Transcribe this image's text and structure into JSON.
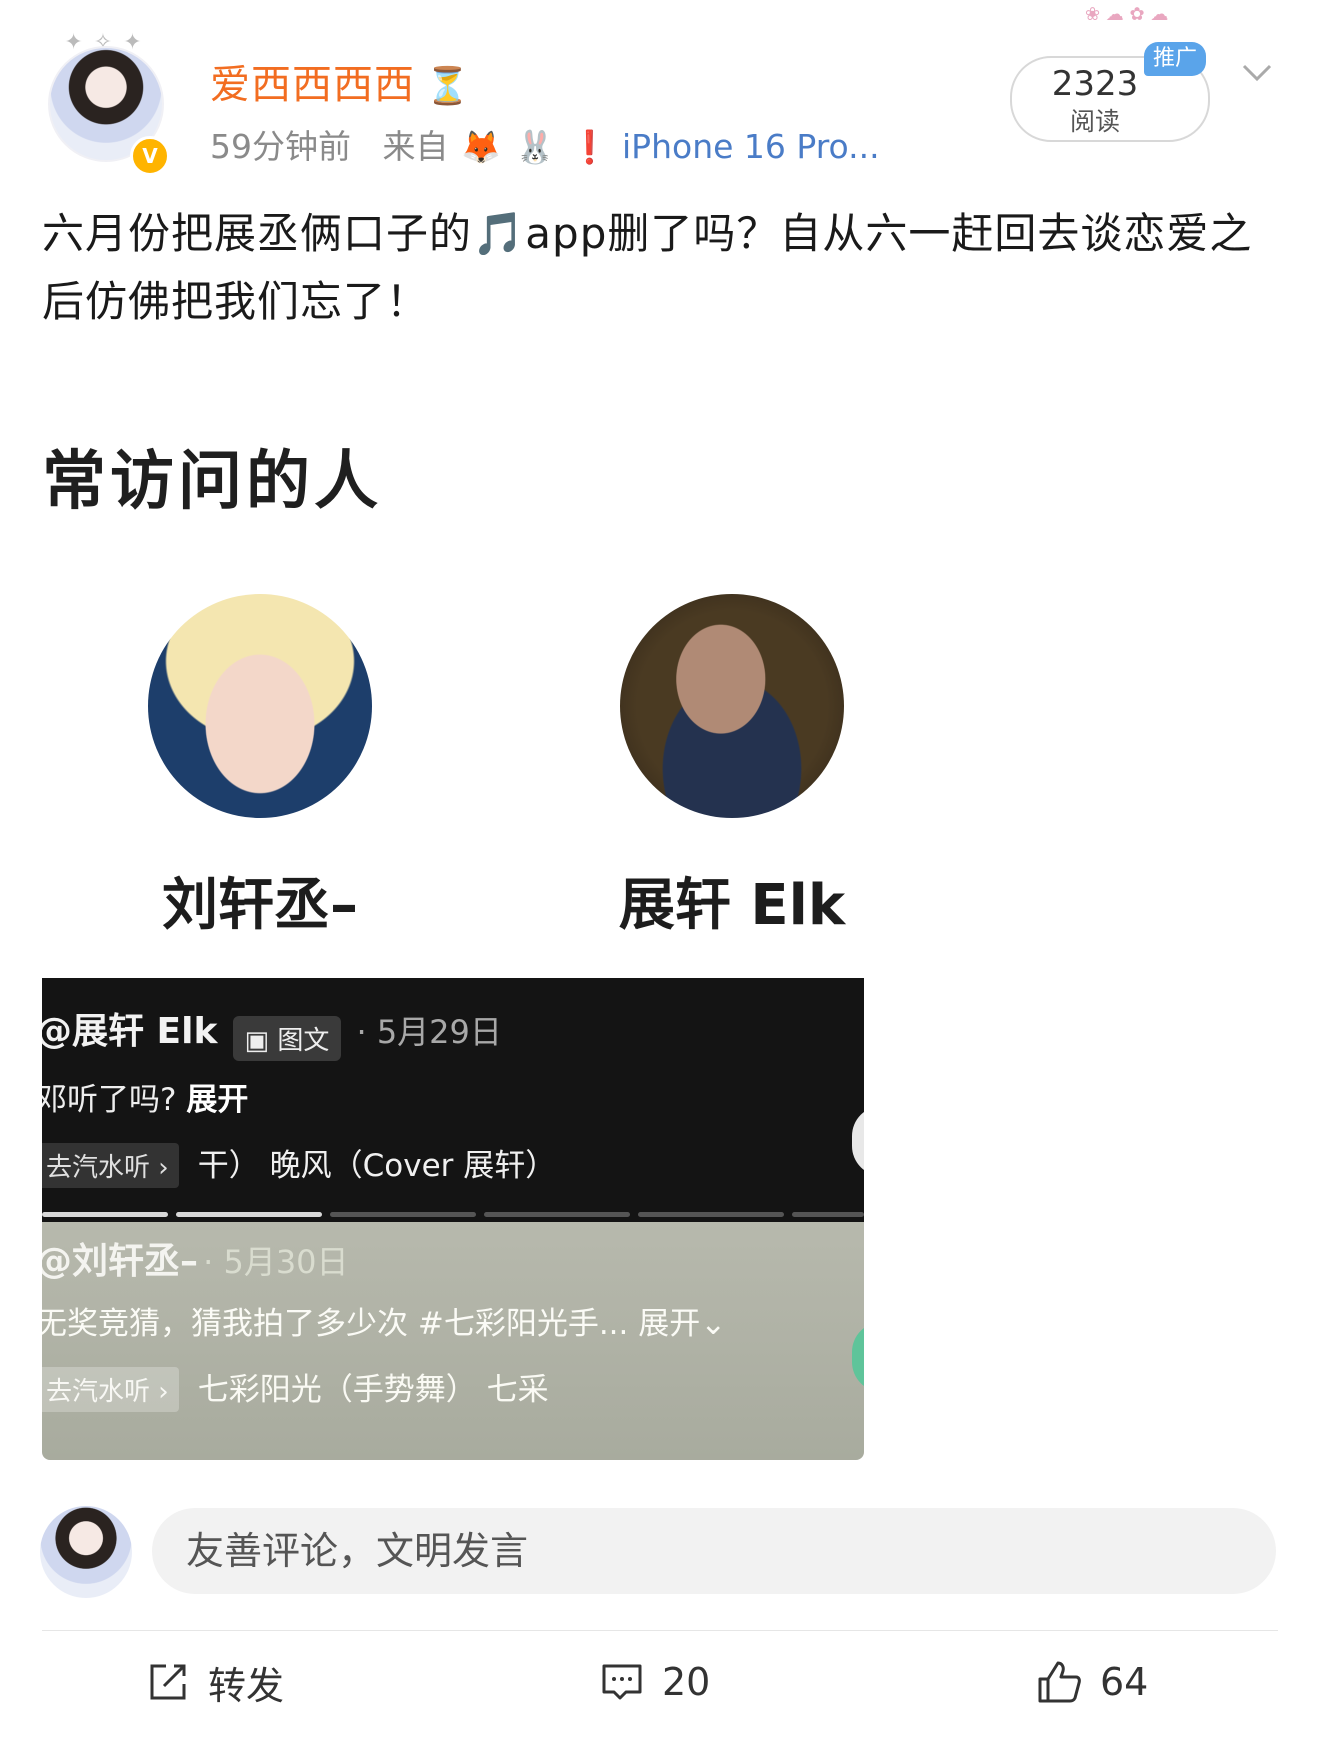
{
  "post": {
    "username": "爱西西西西",
    "time": "59分钟前",
    "source_prefix": "来自",
    "device": "iPhone 16 Pro...",
    "read_count": "2323",
    "read_label": "阅读",
    "promo_label": "推广",
    "text": "六月份把展丞俩口子的🎵app删了吗？自从六一赶回去谈恋爱之后仿佛把我们忘了！"
  },
  "embed": {
    "title": "常访问的人",
    "people": [
      {
        "name": "刘轩丞–"
      },
      {
        "name": "展轩 Elk"
      }
    ],
    "feed": [
      {
        "author": "@展轩 Elk",
        "tag": "图文",
        "date": "· 5月29日",
        "desc_prefix": "邓听了吗?",
        "desc_expand": "展开",
        "music_chip": "去汽水听 ›",
        "music_text": "干）    晚风（Cover 展轩）"
      },
      {
        "author": "@刘轩丞–",
        "date": "· 5月30日",
        "desc": "无奖竞猜，猜我拍了多少次 #七彩阳光手... 展开⌄",
        "music_chip": "去汽水听 ›",
        "music_text": "七彩阳光（手势舞）    七采"
      }
    ],
    "progress": {
      "segments": 6,
      "completed": 2
    }
  },
  "comment_box": {
    "placeholder": "友善评论，文明发言"
  },
  "actions": {
    "repost_label": "转发",
    "comment_count": "20",
    "like_count": "64"
  },
  "colors": {
    "username": "#f26d21",
    "device_link": "#4a7cc7",
    "promo": "#5aa4ea",
    "vip": "#ffb400"
  },
  "icons": [
    "hourglass-icon",
    "fox-emoji",
    "rabbit-emoji",
    "exclamation-emoji",
    "vip-badge-icon",
    "chevron-down-icon",
    "music-note-icon",
    "repost-icon",
    "comment-icon",
    "like-icon"
  ]
}
